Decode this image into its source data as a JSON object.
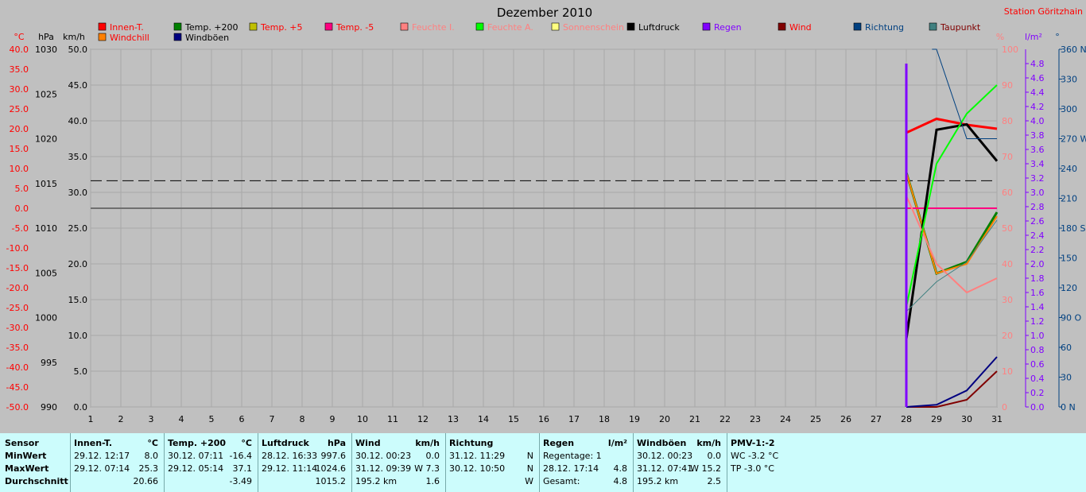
{
  "chart_data": {
    "type": "line",
    "title": "Dezember 2010",
    "station": "Station Göritzhain",
    "x": [
      1,
      2,
      3,
      4,
      5,
      6,
      7,
      8,
      9,
      10,
      11,
      12,
      13,
      14,
      15,
      16,
      17,
      18,
      19,
      20,
      21,
      22,
      23,
      24,
      25,
      26,
      27,
      28,
      29,
      30,
      31
    ],
    "axes": {
      "temp": {
        "unit": "°C",
        "min": -50,
        "max": 40,
        "ticks": [
          "40.0",
          "35.0",
          "30.0",
          "25.0",
          "20.0",
          "15.0",
          "10.0",
          "5.0",
          "0.0",
          "-5.0",
          "-10.0",
          "-15.0",
          "-20.0",
          "-25.0",
          "-30.0",
          "-35.0",
          "-40.0",
          "-45.0",
          "-50.0"
        ]
      },
      "pressure": {
        "unit": "hPa",
        "min": 990,
        "max": 1030,
        "ticks": [
          "1030",
          "1025",
          "1020",
          "1015",
          "1010",
          "1005",
          "1000",
          "995",
          "990"
        ]
      },
      "speed": {
        "unit": "km/h",
        "min": 0,
        "max": 50,
        "ticks": [
          "50.0",
          "45.0",
          "40.0",
          "35.0",
          "30.0",
          "25.0",
          "20.0",
          "15.0",
          "10.0",
          "5.0",
          "0.0"
        ]
      },
      "humidity": {
        "unit": "%",
        "min": 0,
        "max": 100,
        "ticks": [
          "100",
          "90",
          "80",
          "70",
          "60",
          "50",
          "40",
          "30",
          "20",
          "10",
          "0"
        ]
      },
      "rain": {
        "unit": "l/m²",
        "min": 0,
        "max": 5,
        "ticks": [
          "4.8",
          "4.6",
          "4.4",
          "4.2",
          "4.0",
          "3.8",
          "3.6",
          "3.4",
          "3.2",
          "3.0",
          "2.8",
          "2.6",
          "2.4",
          "2.2",
          "2.0",
          "1.8",
          "1.6",
          "1.4",
          "1.2",
          "1.0",
          "0.8",
          "0.6",
          "0.4",
          "0.2",
          "0.0"
        ]
      },
      "direction": {
        "unit": "°",
        "min": 0,
        "max": 360,
        "ticks": [
          "360 N",
          "330",
          "300",
          "270 W",
          "240",
          "210",
          "180 S",
          "150",
          "120",
          "90  O",
          "60",
          "30",
          "0   N"
        ]
      }
    },
    "legend": [
      {
        "name": "Innen-T.",
        "color": "#ff0000"
      },
      {
        "name": "Temp. +200",
        "color": "#008000"
      },
      {
        "name": "Temp. +5",
        "color": "#c0c000"
      },
      {
        "name": "Temp. -5",
        "color": "#ff0080"
      },
      {
        "name": "Feuchte I.",
        "color": "#ff8080"
      },
      {
        "name": "Feuchte A.",
        "color": "#00ff00"
      },
      {
        "name": "Sonnenschein",
        "color": "#ffff80"
      },
      {
        "name": "Luftdruck",
        "color": "#000000"
      },
      {
        "name": "Regen",
        "color": "#8000ff"
      },
      {
        "name": "Wind",
        "color": "#800000"
      },
      {
        "name": "Richtung",
        "color": "#004080"
      },
      {
        "name": "Taupunkt",
        "color": "#408080"
      },
      {
        "name": "Windchill",
        "color": "#ff8000"
      },
      {
        "name": "Windböen",
        "color": "#000080"
      }
    ],
    "series": [
      {
        "name": "Innen-T.",
        "axis": "temp",
        "color": "#ff0000",
        "x": [
          28,
          29,
          30,
          31
        ],
        "values": [
          19.0,
          22.5,
          21.0,
          20.0
        ]
      },
      {
        "name": "Temp. +200",
        "axis": "temp",
        "color": "#008000",
        "x": [
          28,
          29,
          30,
          31
        ],
        "values": [
          9.0,
          -16.4,
          -13.5,
          -1.0
        ]
      },
      {
        "name": "Windchill",
        "axis": "temp",
        "color": "#ff8000",
        "x": [
          28,
          29,
          30,
          31
        ],
        "values": [
          9.0,
          -16.4,
          -14.0,
          -2.0
        ]
      },
      {
        "name": "Temp. -5",
        "axis": "temp",
        "color": "#ff0080",
        "x": [
          28,
          29,
          30,
          31
        ],
        "values": [
          0.0,
          0.0,
          0.0,
          0.0
        ]
      },
      {
        "name": "Luftdruck",
        "axis": "pressure",
        "color": "#000000",
        "x": [
          28,
          29,
          30,
          31
        ],
        "values": [
          997.6,
          1021.0,
          1021.6,
          1017.5
        ]
      },
      {
        "name": "Feuchte I.",
        "axis": "humidity",
        "color": "#ff8080",
        "x": [
          28,
          29,
          30,
          31
        ],
        "values": [
          59,
          40,
          32,
          36
        ]
      },
      {
        "name": "Feuchte A.",
        "axis": "humidity",
        "color": "#00ff00",
        "x": [
          28,
          29,
          30,
          31
        ],
        "values": [
          28,
          68,
          82,
          90
        ]
      },
      {
        "name": "Taupunkt",
        "axis": "temp",
        "color": "#408080",
        "x": [
          28,
          29,
          30,
          31
        ],
        "values": [
          -26.0,
          -18.5,
          -13.5,
          -3.0
        ]
      },
      {
        "name": "Wind",
        "axis": "speed",
        "color": "#800000",
        "x": [
          28,
          29,
          30,
          31
        ],
        "values": [
          0.0,
          0.0,
          1.0,
          5.0
        ]
      },
      {
        "name": "Windböen",
        "axis": "speed",
        "color": "#000080",
        "x": [
          28,
          29,
          30,
          31
        ],
        "values": [
          0.0,
          0.3,
          2.3,
          7.0
        ]
      },
      {
        "name": "Richtung",
        "axis": "direction",
        "color": "#004080",
        "x": [
          28,
          29,
          30,
          31
        ],
        "values": [
          null,
          360,
          270,
          270
        ]
      },
      {
        "name": "Regen",
        "axis": "rain",
        "color": "#8000ff",
        "x": [
          28
        ],
        "values": [
          4.8
        ]
      }
    ],
    "reference_line_pressure": 1015.3,
    "xlim": [
      1,
      31
    ]
  },
  "colors": {
    "plot_bg": "#c0c0c0",
    "panel_bg": "#ccfcfc",
    "grid": "#a8a8a8"
  },
  "stats": {
    "labels": {
      "sensor": "Sensor",
      "min": "MinWert",
      "max": "MaxWert",
      "avg": "Durchschnitt"
    },
    "innen": {
      "title": "Innen-T.",
      "unit": "°C",
      "min_date": "29.12.  12:17",
      "min_val": "8.0",
      "max_date": "29.12.  07:14",
      "max_val": "25.3",
      "avg": "20.66"
    },
    "temp": {
      "title": "Temp. +200",
      "unit": "°C",
      "min_date": "30.12.  07:11",
      "min_val": "-16.4",
      "max_date": "29.12.  05:14",
      "max_val": "37.1",
      "avg": "-3.49"
    },
    "druck": {
      "title": "Luftdruck",
      "unit": "hPa",
      "min_date": "28.12.  16:33",
      "min_val": "997.6",
      "max_date": "29.12.  11:14",
      "max_val": "1024.6",
      "avg": "1015.2"
    },
    "wind": {
      "title": "Wind",
      "unit": "km/h",
      "min_date": "30.12.  00:23",
      "min_val": "0.0",
      "max_date": "31.12.  09:39",
      "max_val": "W 7.3",
      "avg_km": "195.2 km",
      "avg": "1.6"
    },
    "richtung": {
      "title": "Richtung",
      "min_date": "31.12.  11:29",
      "min_val": "N",
      "max_date": "30.12.  10:50",
      "max_val": "N",
      "avg": "W"
    },
    "regen": {
      "title": "Regen",
      "unit": "l/m²",
      "row1": "Regentage: 1",
      "row2_date": "28.12.  17:14",
      "row2_val": "4.8",
      "row3": "Gesamt:",
      "row3_val": "4.8"
    },
    "boeen": {
      "title": "Windböen",
      "unit": "km/h",
      "min_date": "30.12.  00:23",
      "min_val": "0.0",
      "max_date": "31.12.  07:41",
      "max_val": "W 15.2",
      "avg_km": "195.2 km",
      "avg": "2.5"
    },
    "pmv": {
      "title": "PMV-1:-2",
      "wc": "WC -3.2 °C",
      "tp": "TP -3.0 °C"
    }
  }
}
